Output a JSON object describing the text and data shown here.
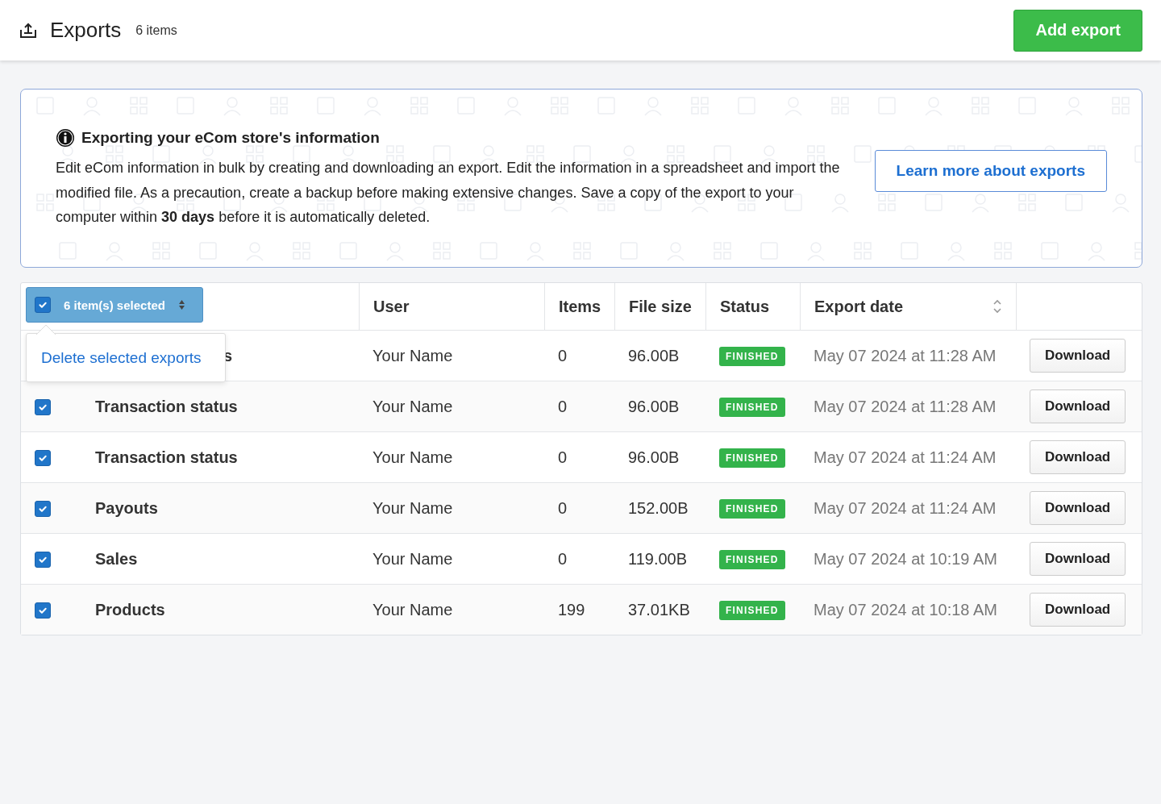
{
  "header": {
    "title": "Exports",
    "count": "6 items",
    "add_button": "Add export"
  },
  "banner": {
    "title": "Exporting your eCom store's information",
    "text": "Edit eCom information in bulk by creating and downloading an export. Edit the information in a spreadsheet and import the modified file. As a precaution, create a backup before making extensive changes. Save a copy of the export to your computer within **30 days** before it is automatically deleted.",
    "button": "Learn more about exports"
  },
  "table": {
    "select_all": {
      "label": "6 item(s) selected",
      "checked": true
    },
    "columns": [
      "User",
      "Items",
      "File size",
      "Status",
      "Export date"
    ],
    "menu": {
      "items": [
        "Delete selected exports"
      ]
    },
    "rows": [
      {
        "name": "s",
        "covered": true,
        "user": "Your Name",
        "items": "0",
        "size": "96.00B",
        "status": "FINISHED",
        "date": "May 07 2024 at 11:28 AM",
        "action": "Download"
      },
      {
        "name": "Transaction status",
        "covered": false,
        "checked": true,
        "user": "Your Name",
        "items": "0",
        "size": "96.00B",
        "status": "FINISHED",
        "date": "May 07 2024 at 11:28 AM",
        "action": "Download"
      },
      {
        "name": "Transaction status",
        "covered": false,
        "checked": true,
        "user": "Your Name",
        "items": "0",
        "size": "96.00B",
        "status": "FINISHED",
        "date": "May 07 2024 at 11:24 AM",
        "action": "Download"
      },
      {
        "name": "Payouts",
        "covered": false,
        "checked": true,
        "user": "Your Name",
        "items": "0",
        "size": "152.00B",
        "status": "FINISHED",
        "date": "May 07 2024 at 11:24 AM",
        "action": "Download"
      },
      {
        "name": "Sales",
        "covered": false,
        "checked": true,
        "user": "Your Name",
        "items": "0",
        "size": "119.00B",
        "status": "FINISHED",
        "date": "May 07 2024 at 10:19 AM",
        "action": "Download"
      },
      {
        "name": "Products",
        "covered": false,
        "checked": true,
        "user": "Your Name",
        "items": "199",
        "size": "37.01KB",
        "status": "FINISHED",
        "date": "May 07 2024 at 10:18 AM",
        "action": "Download"
      }
    ]
  }
}
